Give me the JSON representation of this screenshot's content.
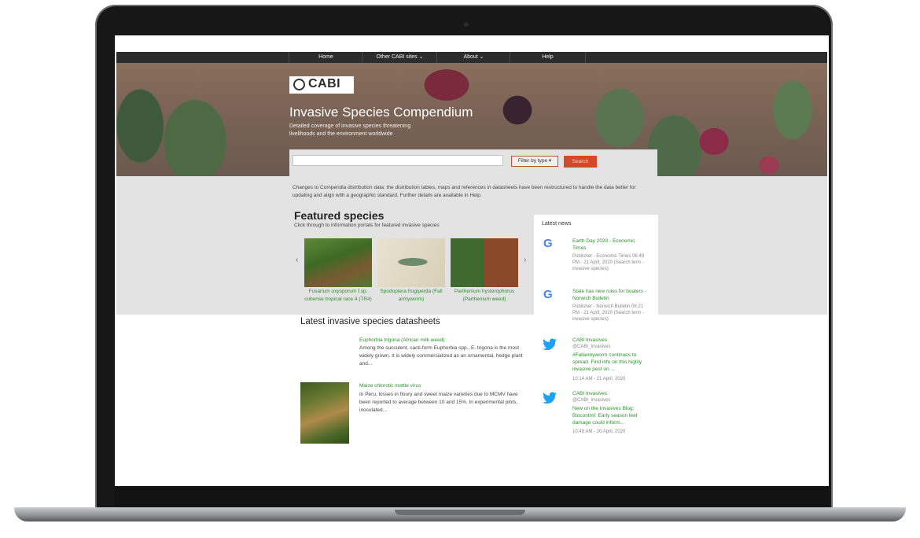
{
  "nav": {
    "home": "Home",
    "other_sites": "Other CABI sites ⌄",
    "about": "About ⌄",
    "help": "Help"
  },
  "logo": {
    "text": "CABI"
  },
  "hero": {
    "title": "Invasive Species Compendium",
    "subtitle": "Detailed coverage of invasive species threatening livelihoods and the environment worldwide"
  },
  "search": {
    "placeholder": "",
    "filter_label": "Filter by type ▾",
    "button_label": "Search"
  },
  "notice": "Changes to Compendia distribution data: the distribution tables, maps and references in datasheets have been restructured to handle the data better for updating and align with a geographic standard. Further details are available in Help.",
  "featured": {
    "title": "Featured species",
    "subtitle": "Click through to information portals for featured invasive species",
    "prev": "‹",
    "next": "›",
    "items": [
      {
        "caption": "Fusarium oxysporum f.sp. cubense tropical race 4 (TR4)"
      },
      {
        "caption": "Spodoptera frugiperda (Fall armyworm)"
      },
      {
        "caption": "Parthenium hysterophorus (Parthenium weed)"
      }
    ]
  },
  "news": {
    "heading": "Latest news",
    "items": [
      {
        "icon": "google-icon",
        "title": "Earth Day 2020 - Economic Times",
        "meta": "Publisher - Economic Times 06:49 PM - 21 April, 2020 (Search term - invasive species)"
      },
      {
        "icon": "google-icon",
        "title": "State has new rules for boaters - Norwich Bulletin",
        "meta": "Publisher - Norwich Bulletin 06:21 PM - 21 April, 2020 (Search term - invasive species)"
      },
      {
        "icon": "twitter-icon",
        "title": "CABI Invasives",
        "handle": "@CABI_Invasives",
        "body": "#Fallarmyworm continues to spread. Find info on this highly invasive pest on ...",
        "meta": "10:14 AM - 21 April, 2020"
      },
      {
        "icon": "twitter-icon",
        "title": "CABI Invasives",
        "handle": "@CABI_Invasives",
        "body": "New on the Invasives Blog: Biocontrol: Early season leaf damage could inform...",
        "meta": "10:49 AM - 20 April, 2020"
      }
    ]
  },
  "datasheets": {
    "title": "Latest invasive species datasheets",
    "items": [
      {
        "name": "Euphorbia trigona (African milk weed)",
        "desc": "Among the succulent, cacti-form Euphorbia spp., E. trigona is the most widely grown. It is widely commercialized as an ornamental, hedge plant and..."
      },
      {
        "name": "Maize chlorotic mottle virus",
        "desc": "In Peru, losses in floury and sweet maize varieties due to MCMV have been reported to average between 10 and 15%. In experimental plots, inoculated..."
      }
    ]
  },
  "colors": {
    "accent_green": "#2e8f2e",
    "search_red": "#d24a2a",
    "nav_dark": "#2c2c2c"
  }
}
